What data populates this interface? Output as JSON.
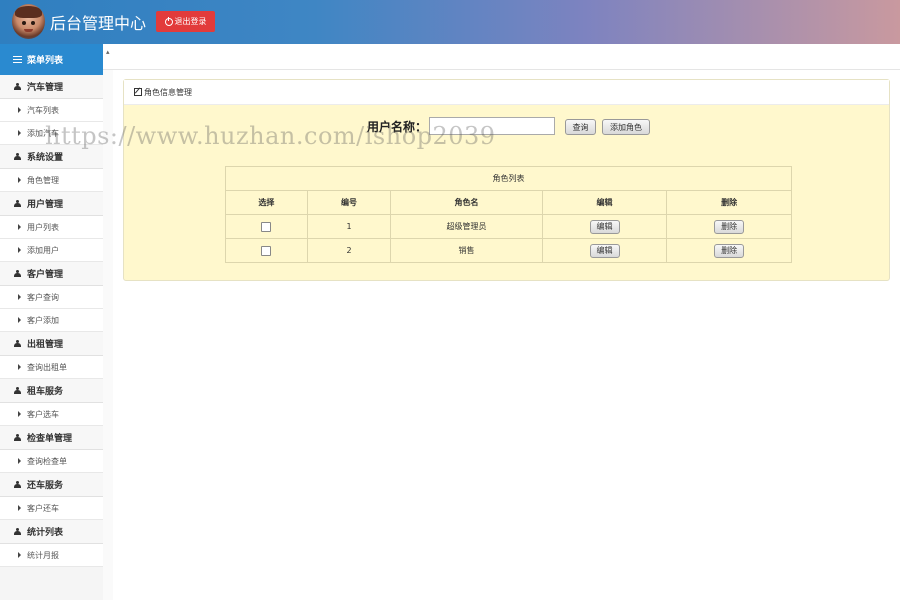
{
  "header": {
    "title": "后台管理中心",
    "logout_label": "退出登录"
  },
  "sidebar": {
    "title": "菜单列表",
    "groups": [
      {
        "label": "汽车管理",
        "items": [
          "汽车列表",
          "添加汽车"
        ]
      },
      {
        "label": "系统设置",
        "items": [
          "角色管理"
        ]
      },
      {
        "label": "用户管理",
        "items": [
          "用户列表",
          "添加用户"
        ]
      },
      {
        "label": "客户管理",
        "items": [
          "客户查询",
          "客户添加"
        ]
      },
      {
        "label": "出租管理",
        "items": [
          "查询出租单"
        ]
      },
      {
        "label": "租车服务",
        "items": [
          "客户选车"
        ]
      },
      {
        "label": "检查单管理",
        "items": [
          "查询检查单"
        ]
      },
      {
        "label": "还车服务",
        "items": [
          "客户还车"
        ]
      },
      {
        "label": "统计列表",
        "items": [
          "统计月报"
        ]
      }
    ]
  },
  "panel": {
    "title": "角色信息管理",
    "search_label": "用户名称：",
    "search_value": "",
    "search_button": "查询",
    "add_button": "添加角色"
  },
  "table": {
    "caption": "角色列表",
    "columns": [
      "选择",
      "编号",
      "角色名",
      "编辑",
      "删除"
    ],
    "rows": [
      {
        "id": "1",
        "name": "超级管理员",
        "edit": "编辑",
        "delete": "删除"
      },
      {
        "id": "2",
        "name": "销售",
        "edit": "编辑",
        "delete": "删除"
      }
    ]
  },
  "watermark": "https://www.huzhan.com/ishop2039",
  "colors": {
    "header_start": "#2f7fc0",
    "header_end": "#c9999f",
    "logout": "#e23b3b",
    "sidebar_title": "#2a8ad0",
    "panel_bg": "#fff8cd"
  }
}
